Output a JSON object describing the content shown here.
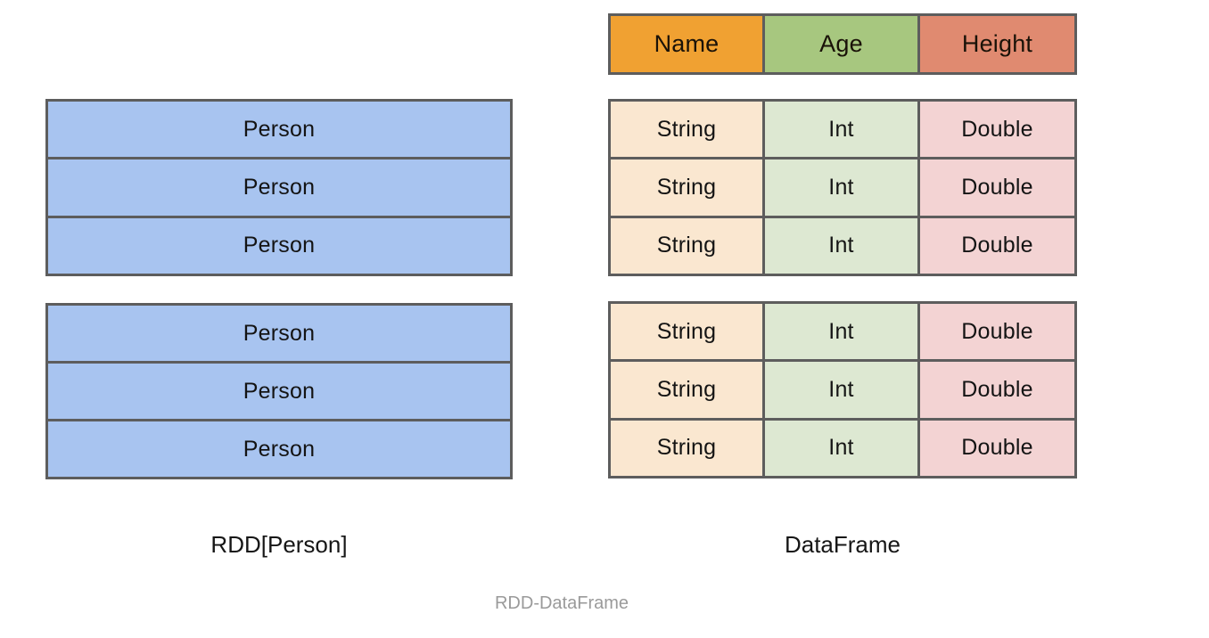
{
  "figure": {
    "caption": "RDD-DataFrame",
    "background_color": "#ffffff",
    "border_color": "#5d5d5d"
  },
  "rdd": {
    "label": "RDD[Person]",
    "row_color": "#a8c4f0",
    "partitions": [
      {
        "rows": [
          "Person",
          "Person",
          "Person"
        ]
      },
      {
        "rows": [
          "Person",
          "Person",
          "Person"
        ]
      }
    ]
  },
  "dataframe": {
    "label": "DataFrame",
    "columns": [
      {
        "name": "Name",
        "type": "String",
        "header_color": "#f0a132",
        "cell_color": "#fae7d0"
      },
      {
        "name": "Age",
        "type": "Int",
        "header_color": "#a7c77f",
        "cell_color": "#dde8d2"
      },
      {
        "name": "Height",
        "type": "Double",
        "header_color": "#e08a70",
        "cell_color": "#f3d3d3"
      }
    ],
    "partitions": [
      {
        "rows": [
          [
            "String",
            "Int",
            "Double"
          ],
          [
            "String",
            "Int",
            "Double"
          ],
          [
            "String",
            "Int",
            "Double"
          ]
        ]
      },
      {
        "rows": [
          [
            "String",
            "Int",
            "Double"
          ],
          [
            "String",
            "Int",
            "Double"
          ],
          [
            "String",
            "Int",
            "Double"
          ]
        ]
      }
    ]
  }
}
